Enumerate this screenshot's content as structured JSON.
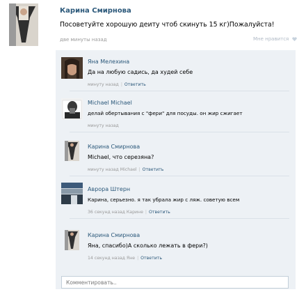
{
  "post": {
    "author": "Карина Смирнова",
    "text": "Посоветуйте хорошую деиту чтоб скинуть 15 кг)Пожалуйста!",
    "time": "две минуты назад",
    "like_label": "Мне нравится"
  },
  "comments": [
    {
      "author": "Яна Мелехина",
      "text": "Да на любую садись, да худей себе",
      "time": "минуту назад",
      "reply_to": "",
      "reply_label": "Ответить"
    },
    {
      "author": "Michael Michael",
      "text": "делай обертывания с \"фери\" для посуды. он жир сжигает",
      "time": "минуту назад",
      "reply_to": "",
      "reply_label": ""
    },
    {
      "author": "Карина Смирнова",
      "text": "Michael, что серезяна?",
      "time": "минуту назад",
      "reply_to": "Michael",
      "reply_label": "Ответить"
    },
    {
      "author": "Аврора Штерн",
      "text": "Карина, серьезно. я так убрала жир с ляж. советую всем",
      "time": "36 секунд назад",
      "reply_to": "Карине",
      "reply_label": "Ответить"
    },
    {
      "author": "Карина Смирнова",
      "text": "Яна, спасибо)А сколько лежать в фери?)",
      "time": "14 секунд назад",
      "reply_to": "Яне",
      "reply_label": "Ответить"
    }
  ],
  "comment_input": {
    "placeholder": "Комментировать.."
  },
  "colors": {
    "link": "#2b587a",
    "meta": "#999999",
    "comments_bg": "#edf1f5"
  }
}
